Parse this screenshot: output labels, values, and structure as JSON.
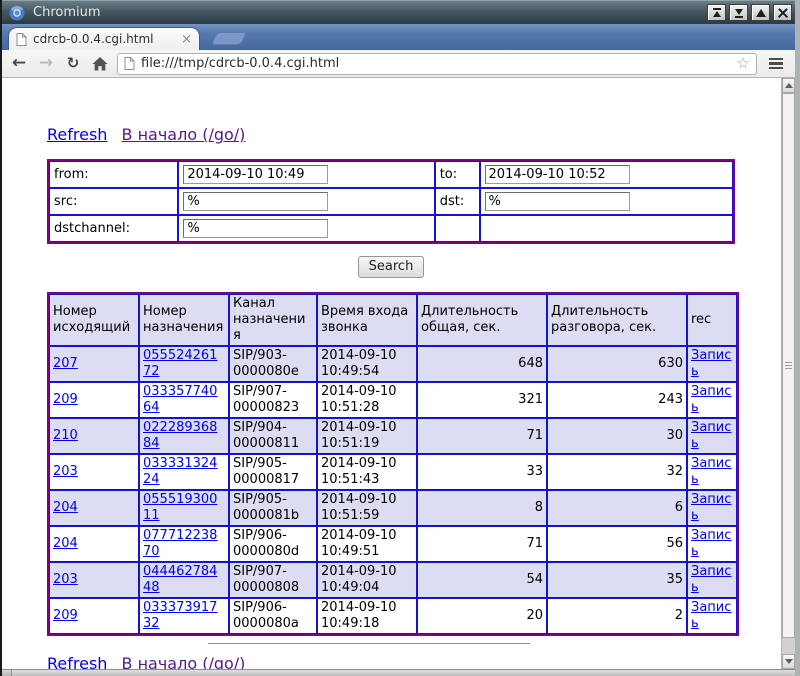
{
  "window": {
    "title": "Chromium"
  },
  "tab": {
    "title": "cdrcb-0.0.4.cgi.html",
    "close_glyph": "×"
  },
  "toolbar": {
    "url": "file:///tmp/cdrcb-0.0.4.cgi.html",
    "icons": {
      "back": "←",
      "forward": "→",
      "reload": "↻",
      "star": "☆"
    }
  },
  "page": {
    "nav": {
      "refresh_label": "Refresh",
      "home_label": "В начало (/go/)"
    },
    "form": {
      "rows": [
        {
          "label1": "from:",
          "value1": "2014-09-10 10:49",
          "label2": "to:",
          "value2": "2014-09-10 10:52"
        },
        {
          "label1": "src:",
          "value1": "%",
          "label2": "dst:",
          "value2": "%"
        },
        {
          "label1": "dstchannel:",
          "value1": "%",
          "label2": "",
          "value2": ""
        }
      ],
      "search_label": "Search"
    },
    "table": {
      "headers": [
        "Номер исходящий",
        "Номер назначения",
        "Канал назначения",
        "Время входа звонка",
        "Длительность общая, сек.",
        "Длительность разговора, сек.",
        "rec"
      ],
      "rows": [
        {
          "src": "207",
          "dst": "05552426172",
          "channel": "SIP/903-0000080e",
          "start": "2014-09-10 10:49:54",
          "total": "648",
          "talk": "630",
          "rec": "Запись"
        },
        {
          "src": "209",
          "dst": "03335774064",
          "channel": "SIP/907-00000823",
          "start": "2014-09-10 10:51:28",
          "total": "321",
          "talk": "243",
          "rec": "Запись"
        },
        {
          "src": "210",
          "dst": "02228936884",
          "channel": "SIP/904-00000811",
          "start": "2014-09-10 10:51:19",
          "total": "71",
          "talk": "30",
          "rec": "Запись"
        },
        {
          "src": "203",
          "dst": "03333132424",
          "channel": "SIP/905-00000817",
          "start": "2014-09-10 10:51:43",
          "total": "33",
          "talk": "32",
          "rec": "Запись"
        },
        {
          "src": "204",
          "dst": "05551930011",
          "channel": "SIP/905-0000081b",
          "start": "2014-09-10 10:51:59",
          "total": "8",
          "talk": "6",
          "rec": "Запись"
        },
        {
          "src": "204",
          "dst": "07771223870",
          "channel": "SIP/906-0000080d",
          "start": "2014-09-10 10:49:51",
          "total": "71",
          "talk": "56",
          "rec": "Запись"
        },
        {
          "src": "203",
          "dst": "04446278448",
          "channel": "SIP/907-00000808",
          "start": "2014-09-10 10:49:04",
          "total": "54",
          "talk": "35",
          "rec": "Запись"
        },
        {
          "src": "209",
          "dst": "03337391732",
          "channel": "SIP/906-0000080a",
          "start": "2014-09-10 10:49:18",
          "total": "20",
          "talk": "2",
          "rec": "Запись"
        }
      ]
    }
  },
  "colors": {
    "outer_table_border": "#800080",
    "inner_table_border": "#1414cc",
    "row_highlight": "#dcdcf2",
    "link": "#0000ee",
    "visited_link": "#551a8b"
  }
}
